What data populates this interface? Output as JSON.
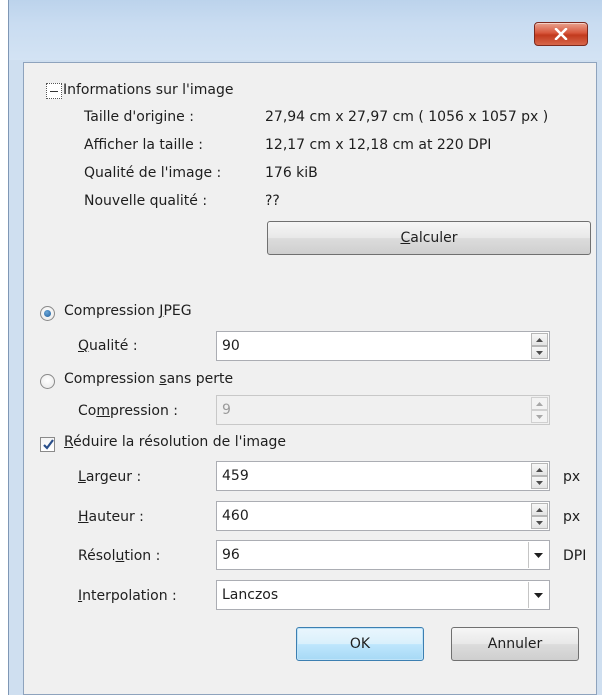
{
  "info": {
    "header": "Informations sur l'image",
    "rows": [
      {
        "label": "Taille d'origine :",
        "value": "27,94 cm x 27,97 cm ( 1056 x 1057 px )"
      },
      {
        "label": "Afficher la taille :",
        "value": "12,17 cm x 12,18 cm at 220 DPI"
      },
      {
        "label": "Qualité de l'image :",
        "value": "176 kiB"
      },
      {
        "label": "Nouvelle qualité :",
        "value": "??"
      }
    ],
    "calculate_button": {
      "pre": "",
      "key": "C",
      "post": "alculer"
    }
  },
  "jpeg": {
    "radio": {
      "pre": "Compression ",
      "key": "J",
      "post": "PEG",
      "checked": true
    },
    "quality_label": {
      "pre": "",
      "key": "Q",
      "post": "ualité :"
    },
    "quality_value": "90"
  },
  "lossless": {
    "radio": {
      "pre": "Compression ",
      "key": "s",
      "post": "ans perte",
      "checked": false
    },
    "compression_label": {
      "pre": "Co",
      "key": "m",
      "post": "pression :"
    },
    "compression_value": "9"
  },
  "reduce": {
    "checkbox": {
      "pre": "",
      "key": "R",
      "post": "éduire la résolution de l'image",
      "checked": true
    },
    "width_label": {
      "pre": "",
      "key": "L",
      "post": "argeur :"
    },
    "width_value": "459",
    "width_unit": "px",
    "height_label": {
      "pre": "",
      "key": "H",
      "post": "auteur :"
    },
    "height_value": "460",
    "height_unit": "px",
    "resolution_label": {
      "pre": "Résol",
      "key": "u",
      "post": "tion :"
    },
    "resolution_value": "96",
    "resolution_unit": "DPI",
    "interpolation_label": {
      "pre": "",
      "key": "I",
      "post": "nterpolation :"
    },
    "interpolation_value": "Lanczos"
  },
  "footer": {
    "ok_label": "OK",
    "cancel_label": "Annuler"
  },
  "icons": {
    "close": "close-icon",
    "collapse": "collapse-icon",
    "spin_up": "spin-up-icon",
    "spin_down": "spin-down-icon",
    "dropdown": "chevron-down-icon",
    "check": "check-icon"
  },
  "colors": {
    "close_button": "#c23a1e",
    "title_bar": "#c9dcf1",
    "client_bg": "#f0f0f0",
    "radio_dot": "#1f5e9c",
    "default_button_border": "#3c7fb1"
  }
}
